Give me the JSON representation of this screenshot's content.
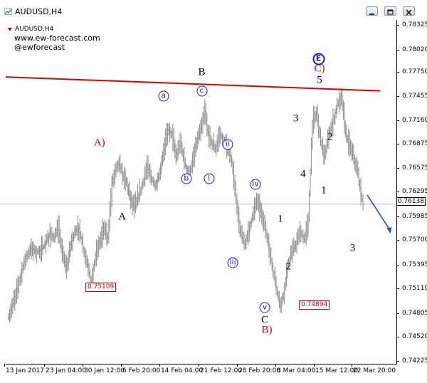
{
  "window": {
    "title": "AUDUSD,H4",
    "symbol_label": "AUDUSD,H4",
    "credit_lines": [
      "www.ew-forecast.com",
      "@ewforecast"
    ]
  },
  "colors": {
    "candle": "#8c8c8c",
    "resistance": "#e00000",
    "wave_blue": "#1a1ad8",
    "wave_red": "#e00000",
    "projection_arrow": "#1a4fd8",
    "price_line": "#c0c0c0"
  },
  "icons": [
    "minimize-icon",
    "restore-icon",
    "close-icon",
    "chart-menu-icon"
  ],
  "chart_data": {
    "type": "candlestick",
    "timeframe": "H4",
    "y_ticks": [
      "0.78325",
      "0.78020",
      "0.77750",
      "0.77455",
      "0.77160",
      "0.76875",
      "0.76575",
      "0.76295",
      "0.75985",
      "0.75700",
      "0.75395",
      "0.75110",
      "0.74805",
      "0.74520",
      "0.74225"
    ],
    "y_tick_values": [
      0.78325,
      0.7802,
      0.7775,
      0.77455,
      0.7716,
      0.76875,
      0.76575,
      0.76295,
      0.75985,
      0.757,
      0.75395,
      0.7511,
      0.74805,
      0.7452,
      0.74225
    ],
    "ylim": [
      0.74225,
      0.78325
    ],
    "x_ticks": [
      "13 Jan 2017",
      "23 Jan 04:00",
      "30 Jan 12:00",
      "6 Feb 20:00",
      "14 Feb 04:00",
      "21 Feb 12:00",
      "28 Feb 20:00",
      "8 Mar 04:00",
      "15 Mar 12:00",
      "22 Mar 20:00"
    ],
    "current_price": "0.76138",
    "marked_lows": [
      {
        "label": "0.75109",
        "value": 0.75109
      },
      {
        "label": "0.74894",
        "value": 0.74894
      }
    ],
    "path": [
      [
        0,
        0.7475
      ],
      [
        8,
        0.751
      ],
      [
        16,
        0.7548
      ],
      [
        22,
        0.756
      ],
      [
        28,
        0.7555
      ],
      [
        34,
        0.7562
      ],
      [
        40,
        0.7578
      ],
      [
        44,
        0.7572
      ],
      [
        48,
        0.7585
      ],
      [
        52,
        0.7552
      ],
      [
        56,
        0.7535
      ],
      [
        60,
        0.7565
      ],
      [
        64,
        0.758
      ],
      [
        68,
        0.7585
      ],
      [
        72,
        0.756
      ],
      [
        76,
        0.754
      ],
      [
        80,
        0.7518
      ],
      [
        84,
        0.7552
      ],
      [
        88,
        0.7568
      ],
      [
        92,
        0.7585
      ],
      [
        96,
        0.7572
      ],
      [
        100,
        0.764
      ],
      [
        103,
        0.7655
      ],
      [
        106,
        0.7665
      ],
      [
        110,
        0.765
      ],
      [
        114,
        0.764
      ],
      [
        118,
        0.762
      ],
      [
        122,
        0.761
      ],
      [
        126,
        0.7625
      ],
      [
        130,
        0.764
      ],
      [
        134,
        0.766
      ],
      [
        138,
        0.7645
      ],
      [
        142,
        0.7635
      ],
      [
        146,
        0.765
      ],
      [
        150,
        0.768
      ],
      [
        154,
        0.7705
      ],
      [
        158,
        0.77
      ],
      [
        162,
        0.767
      ],
      [
        166,
        0.769
      ],
      [
        170,
        0.7665
      ],
      [
        174,
        0.765
      ],
      [
        178,
        0.7665
      ],
      [
        182,
        0.769
      ],
      [
        186,
        0.7705
      ],
      [
        190,
        0.7728
      ],
      [
        192,
        0.7705
      ],
      [
        196,
        0.769
      ],
      [
        200,
        0.768
      ],
      [
        204,
        0.77
      ],
      [
        208,
        0.769
      ],
      [
        212,
        0.768
      ],
      [
        216,
        0.7665
      ],
      [
        220,
        0.762
      ],
      [
        224,
        0.758
      ],
      [
        228,
        0.7565
      ],
      [
        232,
        0.758
      ],
      [
        236,
        0.76
      ],
      [
        240,
        0.762
      ],
      [
        244,
        0.7605
      ],
      [
        248,
        0.7585
      ],
      [
        252,
        0.756
      ],
      [
        256,
        0.753
      ],
      [
        260,
        0.7505
      ],
      [
        263,
        0.7489
      ],
      [
        266,
        0.7505
      ],
      [
        270,
        0.754
      ],
      [
        274,
        0.7555
      ],
      [
        278,
        0.7565
      ],
      [
        282,
        0.758
      ],
      [
        286,
        0.757
      ],
      [
        290,
        0.7595
      ],
      [
        294,
        0.7715
      ],
      [
        298,
        0.7725
      ],
      [
        302,
        0.769
      ],
      [
        306,
        0.7672
      ],
      [
        310,
        0.77
      ],
      [
        314,
        0.7715
      ],
      [
        318,
        0.7735
      ],
      [
        322,
        0.7747
      ],
      [
        326,
        0.77
      ],
      [
        330,
        0.7685
      ],
      [
        334,
        0.767
      ],
      [
        338,
        0.765
      ],
      [
        341,
        0.7625
      ],
      [
        343,
        0.7614
      ]
    ],
    "resistance_line": {
      "start": [
        0,
        0.7769
      ],
      "end": [
        343,
        0.7752
      ]
    },
    "projection": {
      "from": [
        343,
        0.7625
      ],
      "to": [
        355,
        0.7576
      ]
    },
    "wave_labels": [
      {
        "text": "A)",
        "style": "red",
        "t": 88,
        "v": 0.7688
      },
      {
        "text": "A",
        "style": "black",
        "t": 110,
        "v": 0.7598
      },
      {
        "text": "a",
        "style": "circ",
        "t": 150,
        "v": 0.7746
      },
      {
        "text": "b",
        "style": "circ",
        "t": 172,
        "v": 0.7645
      },
      {
        "text": "B",
        "style": "black",
        "t": 187,
        "v": 0.7774
      },
      {
        "text": "c",
        "style": "circ",
        "t": 187,
        "v": 0.7752
      },
      {
        "text": "i",
        "style": "circ",
        "t": 194,
        "v": 0.7645
      },
      {
        "text": "ii",
        "style": "circ",
        "t": 212,
        "v": 0.7687
      },
      {
        "text": "iii",
        "style": "circ",
        "t": 217,
        "v": 0.7542
      },
      {
        "text": "iv",
        "style": "circ",
        "t": 239,
        "v": 0.7638
      },
      {
        "text": "v",
        "style": "circ",
        "t": 248,
        "v": 0.7488
      },
      {
        "text": "C",
        "style": "black",
        "t": 248,
        "v": 0.7472
      },
      {
        "text": "B)",
        "style": "red",
        "t": 250,
        "v": 0.746
      },
      {
        "text": "1",
        "style": "black",
        "t": 263,
        "v": 0.7595
      },
      {
        "text": "2",
        "style": "black",
        "t": 271,
        "v": 0.7537
      },
      {
        "text": "3",
        "style": "black",
        "t": 278,
        "v": 0.7718
      },
      {
        "text": "4",
        "style": "black",
        "t": 285,
        "v": 0.765
      },
      {
        "text": "E",
        "style": "circ2",
        "t": 300,
        "v": 0.7791
      },
      {
        "text": "C)",
        "style": "red",
        "t": 301,
        "v": 0.7779
      },
      {
        "text": "5",
        "style": "black",
        "t": 301,
        "v": 0.7765
      },
      {
        "text": "2",
        "style": "black",
        "t": 311,
        "v": 0.7695
      },
      {
        "text": "1",
        "style": "black",
        "t": 305,
        "v": 0.763
      },
      {
        "text": "3",
        "style": "black",
        "t": 333,
        "v": 0.756
      }
    ]
  }
}
